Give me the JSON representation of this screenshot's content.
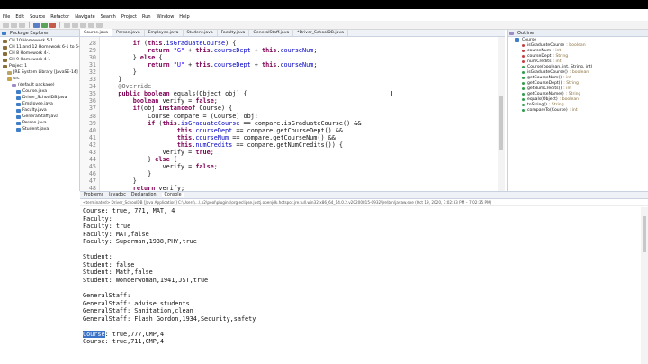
{
  "menu": [
    "File",
    "Edit",
    "Source",
    "Refactor",
    "Navigate",
    "Search",
    "Project",
    "Run",
    "Window",
    "Help"
  ],
  "package_explorer": {
    "title": "Package Explorer",
    "items": [
      {
        "label": "CH 10 Homework 5-1",
        "type": "proj",
        "indent": 0
      },
      {
        "label": "CH 11 and 12 Homework 6-1 to 6-3",
        "type": "proj",
        "indent": 0
      },
      {
        "label": "CH 8 Homework 4-1",
        "type": "proj",
        "indent": 0
      },
      {
        "label": "CH 9 Homework 4-1",
        "type": "proj",
        "indent": 0
      },
      {
        "label": "Project 1",
        "type": "proj",
        "indent": 0
      },
      {
        "label": "JRE System Library [JavaSE-14]",
        "type": "lib",
        "indent": 1
      },
      {
        "label": "src",
        "type": "src",
        "indent": 1
      },
      {
        "label": "(default package)",
        "type": "pkg",
        "indent": 2
      },
      {
        "label": "Course.java",
        "type": "java",
        "indent": 3
      },
      {
        "label": "Driver_SchoolDB.java",
        "type": "java",
        "indent": 3
      },
      {
        "label": "Employee.java",
        "type": "java",
        "indent": 3
      },
      {
        "label": "Faculty.java",
        "type": "java",
        "indent": 3
      },
      {
        "label": "GeneralStaff.java",
        "type": "java",
        "indent": 3
      },
      {
        "label": "Person.java",
        "type": "java",
        "indent": 3
      },
      {
        "label": "Student.java",
        "type": "java",
        "indent": 3
      }
    ]
  },
  "editor": {
    "tabs": [
      "Course.java",
      "Person.java",
      "Employee.java",
      "Student.java",
      "Faculty.java",
      "GeneralStaff.java",
      "*Driver_SchoolDB.java"
    ],
    "active_tab": 0,
    "line_numbers": [
      "28",
      "29",
      "30",
      "31",
      "32",
      "33",
      "34",
      "35",
      "36",
      "37",
      "38",
      "39",
      "40",
      "41",
      "42",
      "43",
      "44",
      "45",
      "46",
      "47",
      "48"
    ],
    "lines": [
      "        if (this.isGraduateCourse) {",
      "            return \"G\" + this.courseDept + this.courseNum;",
      "        } else {",
      "            return \"U\" + this.courseDept + this.courseNum;",
      "        }",
      "    }",
      "    @Override",
      "    public boolean equals(Object obj) {",
      "        boolean verify = false;",
      "        if(obj instanceof Course) {",
      "            Course compare = (Course) obj;",
      "            if (this.isGraduateCourse == compare.isGraduateCourse() &&",
      "                    this.courseDept == compare.getCourseDept() &&",
      "                    this.courseNum == compare.getCourseNum() &&",
      "                    this.numCredits == compare.getNumCredits()) {",
      "                verify = true;",
      "            } else {",
      "                verify = false;",
      "            }",
      "        }",
      "        return verify;"
    ]
  },
  "outline": {
    "title": "Outline",
    "class_name": "Course",
    "members": [
      {
        "name": "isGraduateCourse",
        "type": ": boolean",
        "access": "priv"
      },
      {
        "name": "courseNum",
        "type": ": int",
        "access": "priv"
      },
      {
        "name": "courseDept",
        "type": ": String",
        "access": "priv"
      },
      {
        "name": "numCredits",
        "type": ": int",
        "access": "priv"
      },
      {
        "name": "Course(boolean, int, String, int)",
        "type": "",
        "access": "pub"
      },
      {
        "name": "isGraduateCourse()",
        "type": ": boolean",
        "access": "pub"
      },
      {
        "name": "getCourseNum()",
        "type": ": int",
        "access": "pub"
      },
      {
        "name": "getCourseDept()",
        "type": ": String",
        "access": "pub"
      },
      {
        "name": "getNumCredits()",
        "type": ": int",
        "access": "pub"
      },
      {
        "name": "getCourseName()",
        "type": ": String",
        "access": "pub"
      },
      {
        "name": "equals(Object)",
        "type": ": boolean",
        "access": "pub"
      },
      {
        "name": "toString()",
        "type": ": String",
        "access": "pub"
      },
      {
        "name": "compareTo(Course)",
        "type": ": int",
        "access": "pub"
      }
    ]
  },
  "console": {
    "tabs": [
      "Problems",
      "Javadoc",
      "Declaration",
      "Console"
    ],
    "active_tab": 3,
    "terminated": "<terminated> Driver_SchoolDB [Java Application] C:\\Users\\...\\.p2\\pool\\plugins\\org.eclipse.justj.openjdk.hotspot.jre.full.win32.x86_64_14.0.2.v20200815-0932\\jre\\bin\\javaw.exe  (Oct 19, 2020, 7:02:33 PM – 7:02:35 PM)",
    "lines": [
      "Course: true, 771, MAT, 4",
      "Faculty:",
      "Faculty: true",
      "Faculty: MAT,false",
      "Faculty: Superman,1938,PHY,true",
      "",
      "Student:",
      "Student: false",
      "Student: Math,false",
      "Student: Wonderwoman,1941,JST,true",
      "",
      "GeneralStaff:",
      "GeneralStaff: advise students",
      "GeneralStaff: Sanitation,clean",
      "GeneralStaff: Flash Gordon,1934,Security,safety",
      "",
      "Course: true,777,CMP,4",
      "Course: true,711,CMP,4"
    ],
    "highlight_word": "Course"
  }
}
